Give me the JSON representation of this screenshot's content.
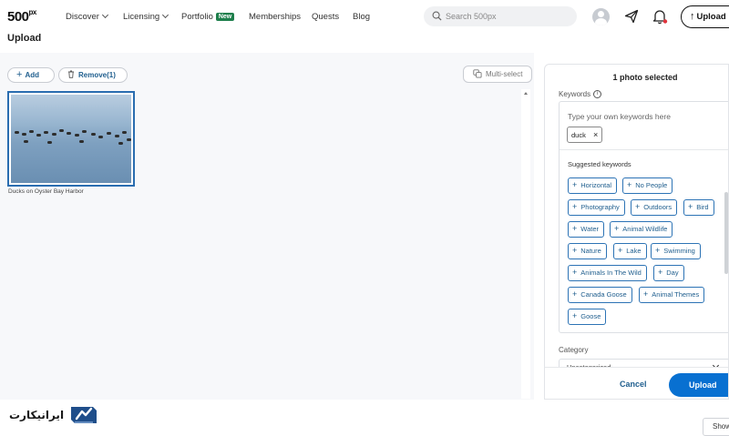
{
  "nav": {
    "logo": "500",
    "logo_sup": "px",
    "items": [
      {
        "label": "Discover",
        "dropdown": true
      },
      {
        "label": "Licensing",
        "dropdown": true
      },
      {
        "label": "Portfolio",
        "badge": "New"
      },
      {
        "label": "Memberships"
      },
      {
        "label": "Quests"
      },
      {
        "label": "Blog"
      }
    ],
    "search_placeholder": "Search 500px",
    "upload_label": "Upload",
    "badge_color": "#1e7f4c",
    "notification_dot_color": "#e0333c"
  },
  "page": {
    "title": "Upload"
  },
  "gallery": {
    "add_label": "Add",
    "remove_label": "Remove(1)",
    "multiselect_label": "Multi-select",
    "photo_caption": "Ducks on Oyster Bay Harbor",
    "selected_border_color": "#2a6db0"
  },
  "panel": {
    "title": "1 photo selected",
    "keywords_label": "Keywords",
    "keywords_placeholder": "Type your own keywords here",
    "keywords": [
      "duck"
    ],
    "suggested_label": "Suggested keywords",
    "suggested": [
      "Horizontal",
      "No People",
      "Photography",
      "Outdoors",
      "Bird",
      "Water",
      "Animal Wildlife",
      "Nature",
      "Lake",
      "Swimming",
      "Animals In The Wild",
      "Day",
      "Canada Goose",
      "Animal Themes",
      "Goose"
    ],
    "category_label": "Category",
    "category_value": "Uncategorized",
    "cancel_label": "Cancel",
    "upload_label": "Upload",
    "accent_color": "#0870d1"
  },
  "watermark": {
    "text": "ایرانیکارت"
  },
  "footer": {
    "show_label": "Show"
  }
}
